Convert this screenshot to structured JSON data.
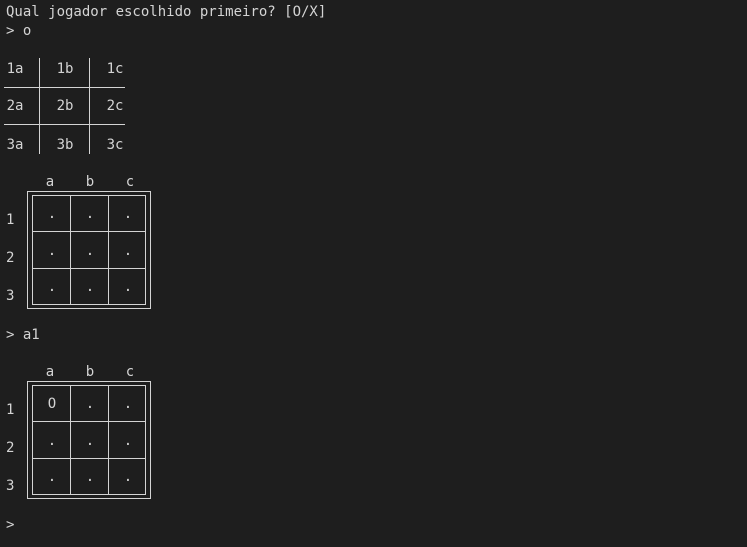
{
  "terminal": {
    "prompt_question": "Qual jogador escolhido primeiro? [O/X]",
    "first_input_line": "> o",
    "reference_grid": [
      [
        "1a",
        "1b",
        "1c"
      ],
      [
        "2a",
        "2b",
        "2c"
      ],
      [
        "3a",
        "3b",
        "3c"
      ]
    ],
    "column_labels": [
      "a",
      "b",
      "c"
    ],
    "row_labels": [
      "1",
      "2",
      "3"
    ],
    "board_1": [
      [
        ".",
        ".",
        "."
      ],
      [
        ".",
        ".",
        "."
      ],
      [
        ".",
        ".",
        "."
      ]
    ],
    "second_input_line": "> a1",
    "board_2": [
      [
        "O",
        ".",
        "."
      ],
      [
        ".",
        ".",
        "."
      ],
      [
        ".",
        ".",
        "."
      ]
    ],
    "final_prompt": ">"
  },
  "colors": {
    "background": "#1e1e1e",
    "text": "#d4d4d4",
    "accent_green": "#3fb87a"
  }
}
